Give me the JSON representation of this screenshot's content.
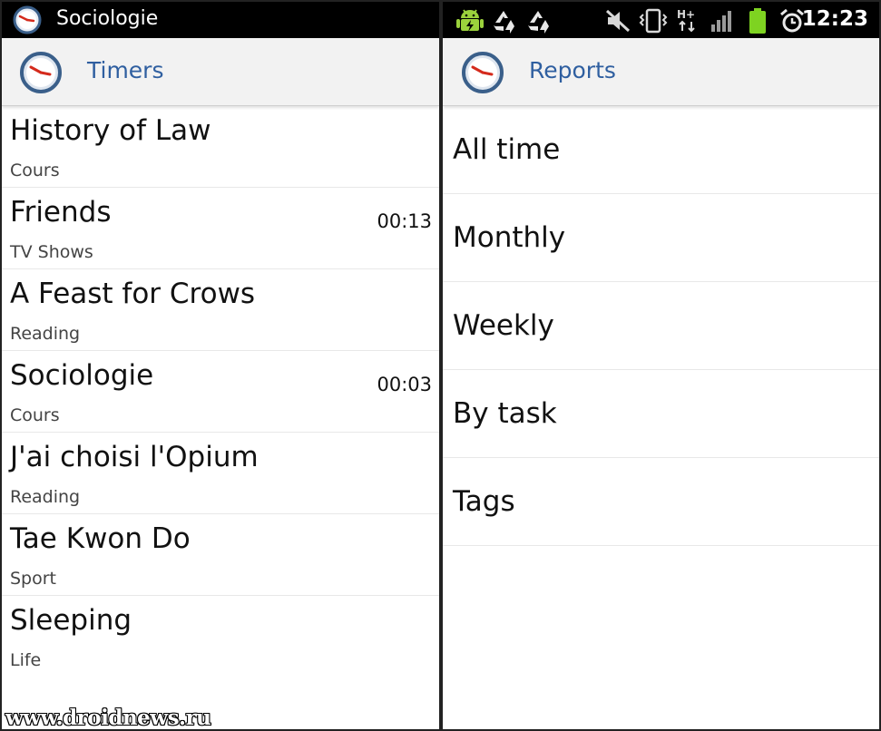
{
  "left_screen": {
    "status_bar": {
      "notification_title": "Sociologie",
      "notification_icon": "clock-icon"
    },
    "app_bar": {
      "title": "Timers",
      "icon": "clock-icon"
    },
    "timers": [
      {
        "name": "History of Law",
        "category": "Cours",
        "time": ""
      },
      {
        "name": "Friends",
        "category": "TV Shows",
        "time": "00:13"
      },
      {
        "name": "A Feast for Crows",
        "category": "Reading",
        "time": ""
      },
      {
        "name": "Sociologie",
        "category": "Cours",
        "time": "00:03"
      },
      {
        "name": "J'ai choisi l'Opium",
        "category": "Reading",
        "time": ""
      },
      {
        "name": "Tae Kwon Do",
        "category": "Sport",
        "time": ""
      },
      {
        "name": "Sleeping",
        "category": "Life",
        "time": ""
      }
    ],
    "watermark": "www.droidnews.ru"
  },
  "right_screen": {
    "status_bar": {
      "time": "12:23",
      "icons": [
        "android-usb-icon",
        "recycle-icon",
        "recycle-icon",
        "mute-icon",
        "vibrate-icon",
        "hplus-data-icon",
        "signal-icon",
        "battery-icon",
        "alarm-icon"
      ]
    },
    "app_bar": {
      "title": "Reports",
      "icon": "clock-icon"
    },
    "reports": [
      {
        "label": "All time"
      },
      {
        "label": "Monthly"
      },
      {
        "label": "Weekly"
      },
      {
        "label": "By task"
      },
      {
        "label": "Tags"
      }
    ]
  },
  "colors": {
    "title_blue": "#2f5fa0",
    "clock_red": "#d42a1c",
    "clock_ring": "#3a5f8a",
    "android_green": "#9bd23c",
    "battery_green": "#7ed321"
  }
}
